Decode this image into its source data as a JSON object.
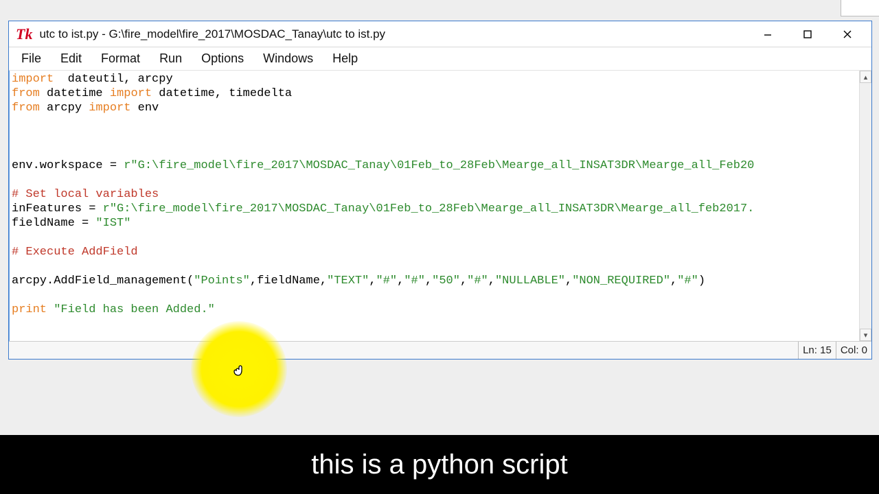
{
  "window": {
    "title": "utc to ist.py - G:\\fire_model\\fire_2017\\MOSDAC_Tanay\\utc to ist.py"
  },
  "menu": [
    "File",
    "Edit",
    "Format",
    "Run",
    "Options",
    "Windows",
    "Help"
  ],
  "code": {
    "l1_kw": "import",
    "l1_rest": "  dateutil, arcpy",
    "l2_kw1": "from",
    "l2_mid": " datetime ",
    "l2_kw2": "import",
    "l2_rest": " datetime, timedelta",
    "l3_kw1": "from",
    "l3_mid": " arcpy ",
    "l3_kw2": "import",
    "l3_rest": " env",
    "l7_lhs": "env.workspace = ",
    "l7_str": "r\"G:\\fire_model\\fire_2017\\MOSDAC_Tanay\\01Feb_to_28Feb\\Mearge_all_INSAT3DR\\Mearge_all_Feb20",
    "l9_cm": "# Set local variables",
    "l10_lhs": "inFeatures = ",
    "l10_str": "r\"G:\\fire_model\\fire_2017\\MOSDAC_Tanay\\01Feb_to_28Feb\\Mearge_all_INSAT3DR\\Mearge_all_feb2017.",
    "l11_lhs": "fieldName = ",
    "l11_str": "\"IST\"",
    "l13_cm": "# Execute AddField",
    "l15_a": "arcpy.AddField_management(",
    "l15_s1": "\"Points\"",
    "l15_b": ",fieldName,",
    "l15_s2": "\"TEXT\"",
    "l15_c": ",",
    "l15_s3": "\"#\"",
    "l15_d": ",",
    "l15_s4": "\"#\"",
    "l15_e": ",",
    "l15_s5": "\"50\"",
    "l15_f": ",",
    "l15_s6": "\"#\"",
    "l15_g": ",",
    "l15_s7": "\"NULLABLE\"",
    "l15_h": ",",
    "l15_s8": "\"NON_REQUIRED\"",
    "l15_i": ",",
    "l15_s9": "\"#\"",
    "l15_j": ")",
    "l17_kw": "print",
    "l17_sp": " ",
    "l17_str": "\"Field has been Added.\""
  },
  "status": {
    "ln": "Ln: 15",
    "col": "Col: 0"
  },
  "caption": "this is a python script"
}
